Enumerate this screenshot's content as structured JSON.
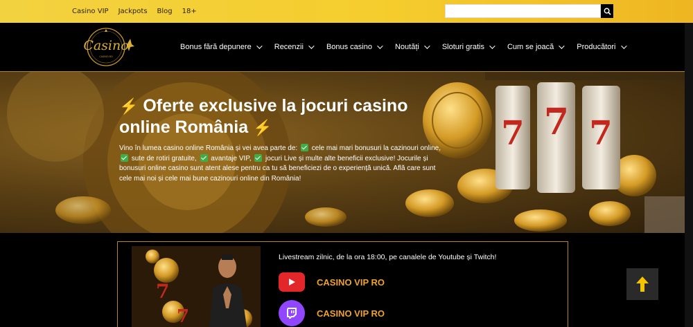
{
  "topbar": {
    "links": [
      "Casino VIP",
      "Jackpots",
      "Blog",
      "18+"
    ],
    "search_placeholder": "",
    "search_icon": "search-icon"
  },
  "brand": {
    "logo_text": "Casino",
    "logo_subtext": "CASINO.RO"
  },
  "nav": {
    "items": [
      "Bonus fără depunere",
      "Recenzii",
      "Bonus casino",
      "Noutăți",
      "Sloturi gratis",
      "Cum se joacă",
      "Producători"
    ]
  },
  "hero": {
    "title_line1": "Oferte exclusive la jocuri casino",
    "title_line2": "online România",
    "text_1": "Vino în lumea casino online România și vei avea parte de:",
    "text_2": "cele mai mari bonusuri la cazinouri online,",
    "text_3": "sute de rotiri gratuite,",
    "text_4": "avantaje VIP,",
    "text_5": "jocuri Live și multe alte beneficii exclusive!",
    "text_6": "Jocurile și bonusuri online casino sunt atent alese pentru ca tu să beneficiezi de o experiență unică.",
    "text_7": "Află care sunt cele mai noi și cele mai bune cazinouri online din România!",
    "accent_color": "#f2772a",
    "check_color": "#3fae49"
  },
  "livestream": {
    "text": "Livestream zilnic, de la ora 18:00, pe canalele de Youtube și Twitch!",
    "channels": [
      {
        "name": "CASINO VIP RO",
        "platform": "youtube",
        "color": "#e2262a"
      },
      {
        "name": "CASINO VIP RO",
        "platform": "twitch",
        "color": "#9146ff"
      }
    ]
  },
  "colors": {
    "gold": "#f3d240",
    "label_orange": "#f0a32a",
    "border_gold": "#b58b16"
  }
}
